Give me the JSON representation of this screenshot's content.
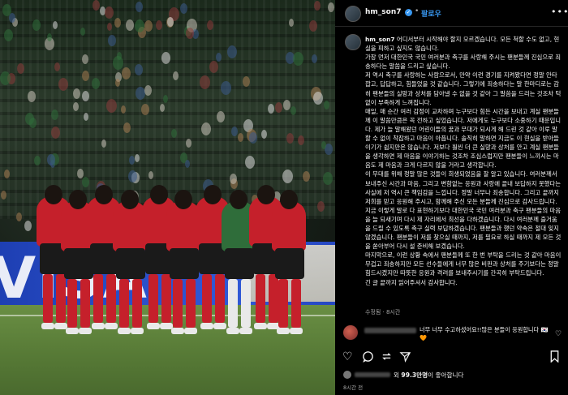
{
  "post": {
    "username": "hm_son7",
    "follow_label": "팔로우",
    "more_label": "•••",
    "photo_banner_text": "VISA"
  },
  "caption": {
    "paragraphs": [
      "어디서부터 시작해야 할지 모르겠습니다. 모든 척할 수도 없고, 현실을 피하고 싶지도 않습니다.",
      "가장 먼저 대한민국 국민 여러분과 축구를 사랑해 주시는 팬분들께 진심으로 죄송하다는 말씀을 드리고 싶습니다.",
      "저 역시 축구를 사랑하는 사람으로서, 만약 이런 경기를 지켜봤다면 정말 안타깝고, 답답하고, 힘들었을 것 같습니다. 그렇기에 죄송하다는 말 한마디로는 감히 팬분들의 실망과 상처를 담아낼 수 없을 것 같아 그 말씀을 드리는 것조차 턱없이 부족하게 느껴집니다.",
      "매일, 매 순간 여러 감정이 교차하며 누구보다 힘든 시간을 보내고 계실 팬분들께 이 말씀만큼은 꼭 전하고 싶었습니다. 저에게도 누구보다 소중하기 때문입니다. 제가 늘 말해왔던 어린이들의 꿈과 무대가 되시게 해 드린 것 같아 이루 말할 수 없이 착잡하고 마음이 아픕니다. 솔직히 말하면 지금도 이 현실을 받아들이기가 쉽지만은 않습니다. 저보다 훨씬 더 큰 실망과 상처를 안고 계실 팬분들을 생각하면 제 마음을 이야기하는 것조차 조심스럽지만 팬분들이 느끼시는 마음도 제 마음과 크게 다르지 않을 거라고 생각합니다.",
      "이 무대를 위해 정말 많은 것들이 희생되었음을 잘 알고 있습니다. 여러분께서 보내주신 시간과 마음, 그리고 변함없는 응원과 사랑에 끝내 보답하지 못했다는 사실에 저 역시 큰 책임감을 느낍니다. 정말 너무나 죄송합니다. 그리고 끝까지 저희를 믿고 응원해 주시고, 함께해 주신 모든 분들께 진심으로 감사드립니다.",
      "지금 이렇게 말로 다 표현하기보다 대한민국 국민 여러분과 축구 팬분들의 마음을 늘 되새기며 다시 제 자리에서 최선을 다하겠습니다. 다시 여러분께 즐거움을 드릴 수 있도록 축구 실력 보답하겠습니다. 팬분들과 했던 약속은 절대 잊지 않겠습니다. 팬분들이 저를 찾으실 때까지, 저를 필요로 하실 때까지 제 모든 것을 쏟아부어 다시 설 준비해 보겠습니다.",
      "마지막으로, 이런 상황 속에서 팬분들께 또 한 번 부탁을 드리는 것 같아 마음이 무겁고 죄송하지만 모든 선수들에게 너무 많은 비판과 상처를 주기보다는 정말 힘드시겠지만 따뜻한 응원과 격려를 보내주시기를 간곡히 부탁드립니다.",
      "긴 글 끝까지 읽어주셔서 감사합니다."
    ]
  },
  "meta": {
    "edited_label": "수정됨 · 8시간"
  },
  "comment": {
    "text": "너무 너무 수고하셨어요!!많은 분들이 응원합니다 🇰🇷🧡"
  },
  "actions": {
    "like_icon": "heart-icon",
    "comment_icon": "comment-icon",
    "share_icon": "share-icon",
    "save_icon": "bookmark-icon"
  },
  "likes": {
    "text_prefix": "외 ",
    "count": "99.3만명",
    "text_suffix": "이 좋아합니다"
  },
  "time": {
    "label": "8시간 전"
  },
  "colors": {
    "accent": "#3897f0",
    "jersey": "#c5202b",
    "banner": "#2a50c9",
    "pitch": "#577a36"
  }
}
